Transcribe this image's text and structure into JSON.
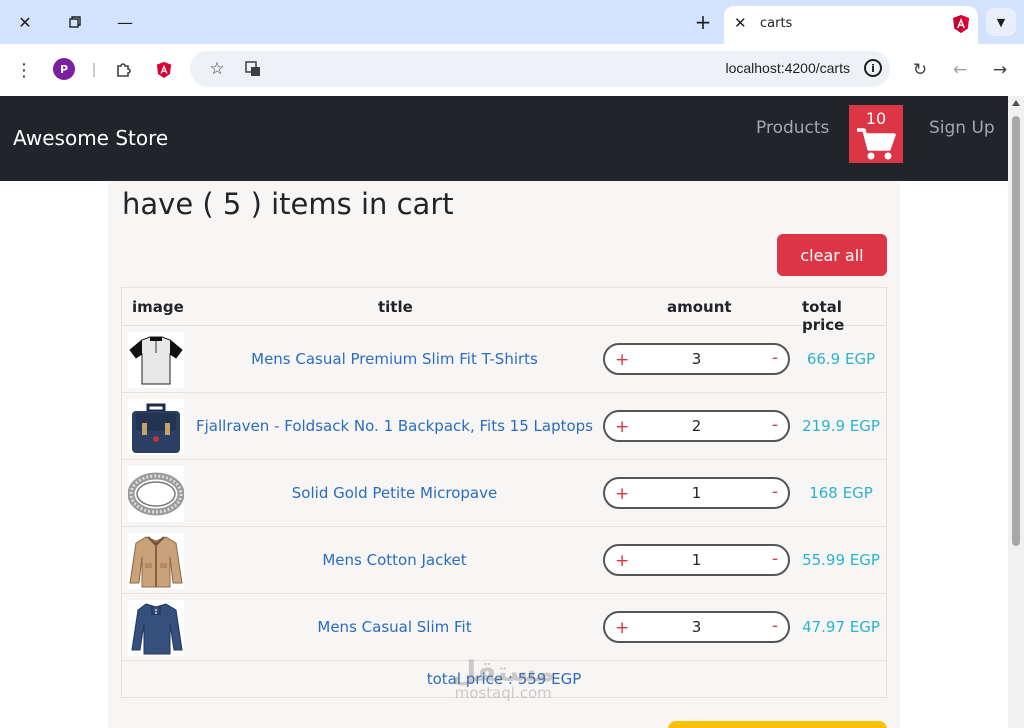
{
  "browser": {
    "tab_title": "carts",
    "url": "localhost:4200/carts",
    "profile_initial": "P"
  },
  "navbar": {
    "brand": "Awesome Store",
    "products_link": "Products",
    "cart_count": "10",
    "signup_link": "Sign Up"
  },
  "cart": {
    "heading": "have ( 5 ) items in cart",
    "clear_label": "clear all",
    "columns": {
      "image": "image",
      "title": "title",
      "amount": "amount",
      "total_price": "total price"
    },
    "plus_symbol": "+",
    "minus_symbol": "-",
    "items": [
      {
        "title": "Mens Casual Premium Slim Fit T-Shirts",
        "quantity": "3",
        "total": "66.9 EGP",
        "thumb": "tshirt"
      },
      {
        "title": "Fjallraven - Foldsack No. 1 Backpack, Fits 15 Laptops",
        "quantity": "2",
        "total": "219.9 EGP",
        "thumb": "backpack"
      },
      {
        "title": "Solid Gold Petite Micropave",
        "quantity": "1",
        "total": "168 EGP",
        "thumb": "ring"
      },
      {
        "title": "Mens Cotton Jacket",
        "quantity": "1",
        "total": "55.99 EGP",
        "thumb": "jacket"
      },
      {
        "title": "Mens Casual Slim Fit",
        "quantity": "3",
        "total": "47.97 EGP",
        "thumb": "longsleeve"
      }
    ],
    "total_text": "total price : 559 EGP"
  },
  "watermark": {
    "arabic": "مستقل",
    "latin": "mostaql.com"
  },
  "colors": {
    "navbar": "#212529",
    "danger": "#dc3545",
    "link": "#2a6cc2",
    "price": "#2bb3cc",
    "warning": "#ffc107"
  }
}
